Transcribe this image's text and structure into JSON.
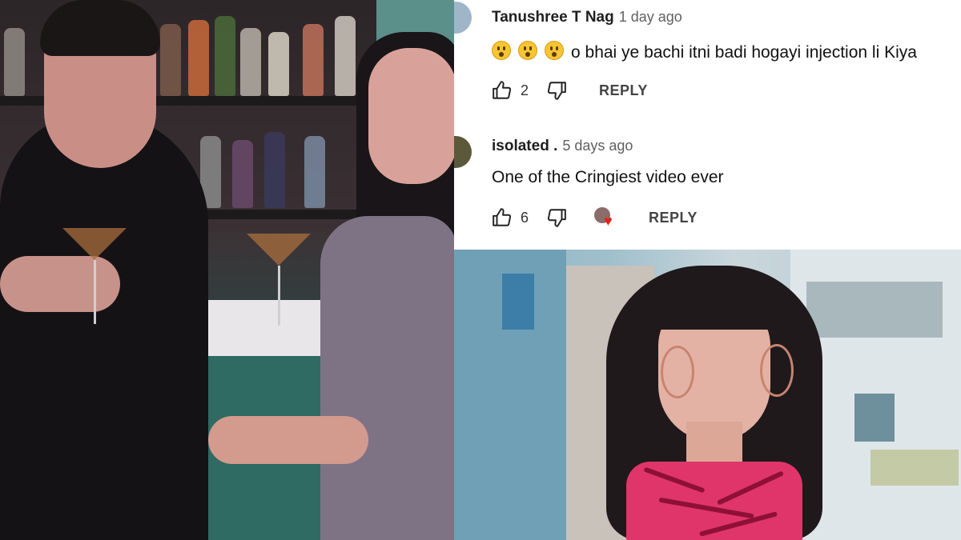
{
  "left_photo": {
    "description_icon": "bar-scene-photo"
  },
  "comments": [
    {
      "author": "Tanushree T Nag",
      "time": "1 day ago",
      "emoji_count": 3,
      "text": "o bhai ye bachi itni badi hogayi injection li Kiya",
      "likes": "2",
      "reply_label": "REPLY",
      "avatar_color": "#9fb6c9",
      "creator_heart": false
    },
    {
      "author": "isolated .",
      "time": "5 days ago",
      "text": "One of the  Cringiest video ever",
      "likes": "6",
      "reply_label": "REPLY",
      "avatar_color": "#5a5a3a",
      "creator_heart": true
    }
  ],
  "right_photo": {
    "description_icon": "portrait-photo"
  },
  "colors": {
    "accent_heart": "#e0231c",
    "text": "#111111",
    "meta": "#606060"
  }
}
